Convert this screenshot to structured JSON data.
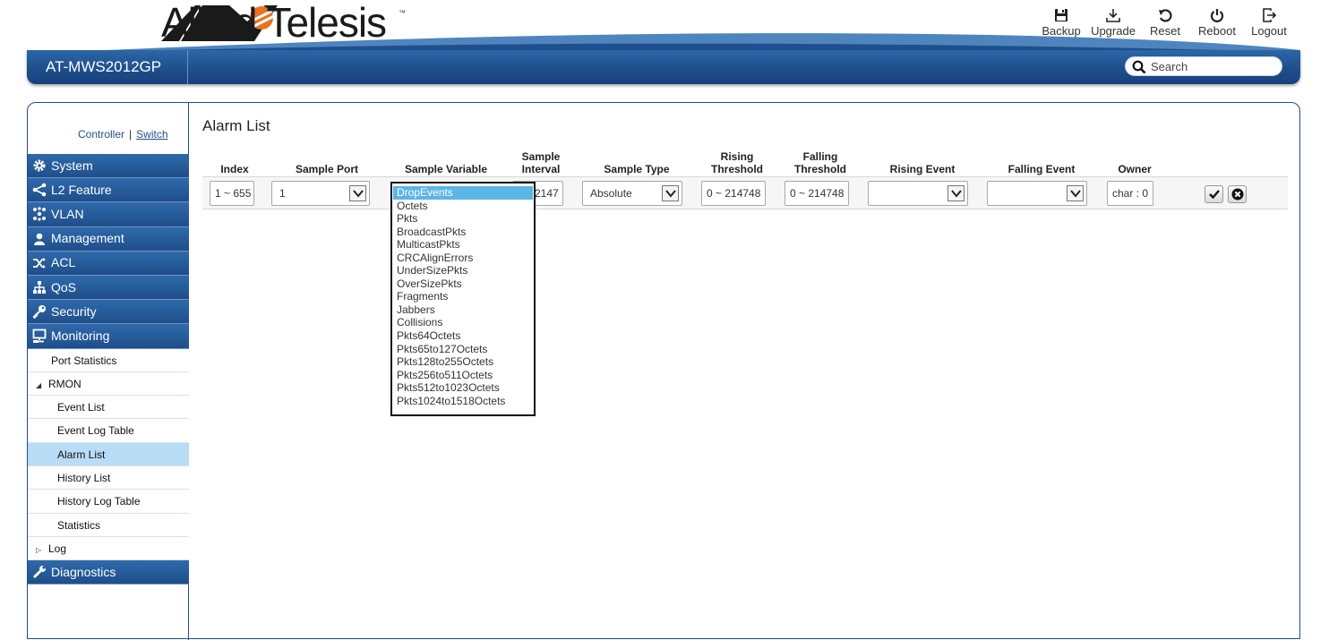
{
  "brand": {
    "name": "Allied Telesis",
    "tm": "™"
  },
  "toolbar": [
    {
      "key": "backup",
      "label": "Backup",
      "icon": "save-icon"
    },
    {
      "key": "upgrade",
      "label": "Upgrade",
      "icon": "download-icon"
    },
    {
      "key": "reset",
      "label": "Reset",
      "icon": "reset-icon"
    },
    {
      "key": "reboot",
      "label": "Reboot",
      "icon": "power-icon"
    },
    {
      "key": "logout",
      "label": "Logout",
      "icon": "logout-icon"
    }
  ],
  "header": {
    "device": "AT-MWS2012GP",
    "search_placeholder": "Search"
  },
  "mode": {
    "controller": "Controller",
    "separator": "|",
    "switch": "Switch"
  },
  "sidebar": {
    "items": [
      {
        "label": "System",
        "icon": "gear-icon"
      },
      {
        "label": "L2 Feature",
        "icon": "share-icon"
      },
      {
        "label": "VLAN",
        "icon": "network-icon"
      },
      {
        "label": "Management",
        "icon": "user-icon"
      },
      {
        "label": "ACL",
        "icon": "shuffle-icon"
      },
      {
        "label": "QoS",
        "icon": "sitemap-icon"
      },
      {
        "label": "Security",
        "icon": "key-icon"
      },
      {
        "label": "Monitoring",
        "icon": "monitor-icon"
      }
    ],
    "monitoring_sub": {
      "port_statistics": "Port Statistics",
      "rmon": "RMON",
      "rmon_children": [
        "Event List",
        "Event Log Table",
        "Alarm List",
        "History List",
        "History Log Table",
        "Statistics"
      ],
      "log": "Log"
    },
    "diagnostics": {
      "label": "Diagnostics",
      "icon": "wrench-icon"
    }
  },
  "page": {
    "title": "Alarm List"
  },
  "table": {
    "headers": {
      "index": "Index",
      "sample_port": "Sample Port",
      "sample_variable": "Sample Variable",
      "sample_interval_1": "Sample",
      "sample_interval_2": "Interval",
      "sample_type": "Sample Type",
      "rising_threshold_1": "Rising",
      "rising_threshold_2": "Threshold",
      "falling_threshold_1": "Falling",
      "falling_threshold_2": "Threshold",
      "rising_event": "Rising Event",
      "falling_event": "Falling Event",
      "owner": "Owner"
    },
    "row": {
      "index": "1 ~ 655",
      "sample_port": "1",
      "sample_interval": "2147",
      "sample_type": "Absolute",
      "rising_threshold": "0 ~ 214748",
      "falling_threshold": "0 ~ 214748",
      "rising_event": "",
      "falling_event": "",
      "owner": "char : 0"
    }
  },
  "sample_variable_options": [
    "DropEvents",
    "Octets",
    "Pkts",
    "BroadcastPkts",
    "MulticastPkts",
    "CRCAlignErrors",
    "UnderSizePkts",
    "OverSizePkts",
    "Fragments",
    "Jabbers",
    "Collisions",
    "Pkts64Octets",
    "Pkts65to127Octets",
    "Pkts128to255Octets",
    "Pkts256to511Octets",
    "Pkts512to1023Octets",
    "Pkts1024to1518Octets"
  ],
  "sample_variable_selected": "DropEvents",
  "colors": {
    "accent": "#1f4f8c",
    "highlight": "#5bb5e6",
    "selected_row": "#b9dcf7"
  }
}
